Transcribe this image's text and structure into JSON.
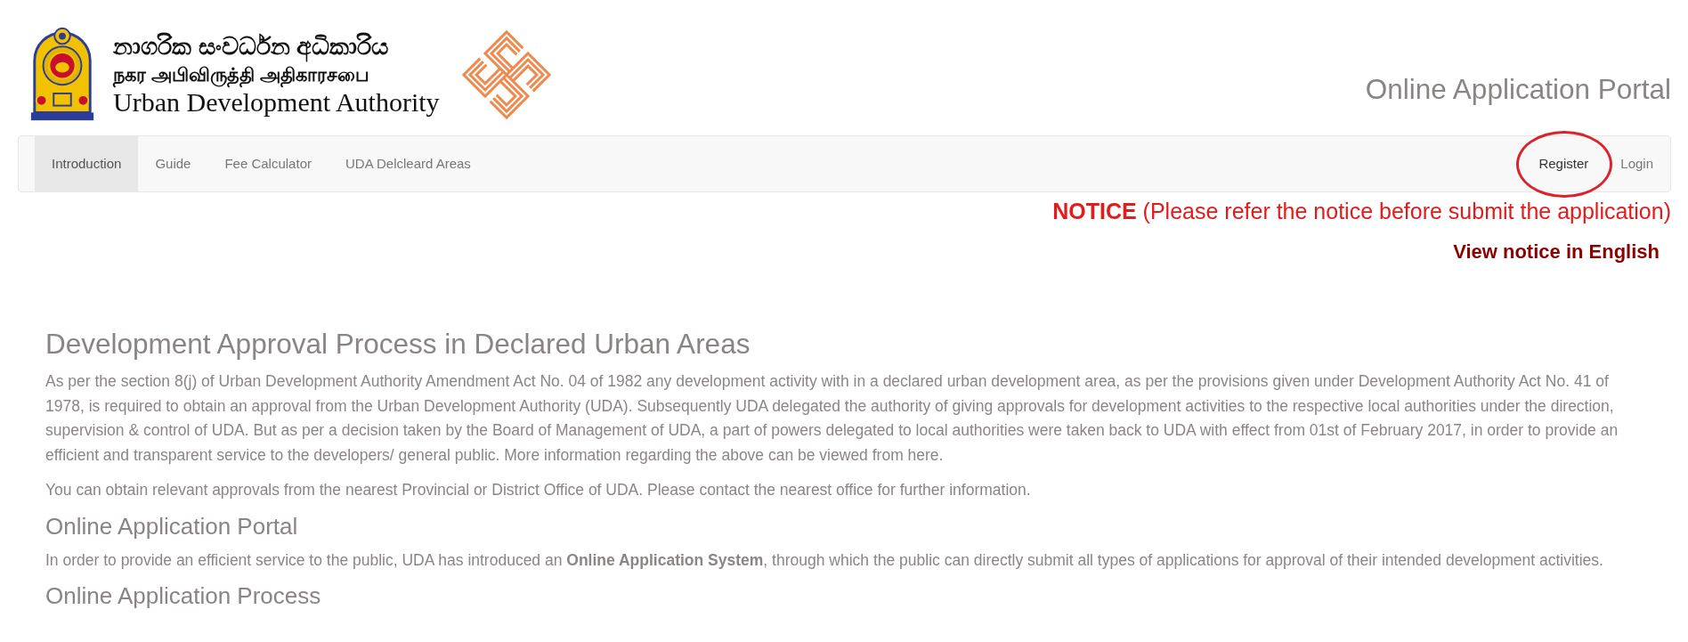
{
  "header": {
    "logo_lines": [
      "නාගරික සංවර්ධන අධිකාරිය",
      "நகர அபிவிருத்தி அதிகாரசபை",
      "Urban Development Authority"
    ],
    "portal_title": "Online Application Portal"
  },
  "navbar": {
    "left_items": [
      {
        "label": "Introduction",
        "selected": true
      },
      {
        "label": "Guide",
        "selected": false
      },
      {
        "label": "Fee Calculator",
        "selected": false
      },
      {
        "label": "UDA Delcleard Areas",
        "selected": false
      }
    ],
    "right_items": [
      {
        "label": "Register",
        "hovered": true,
        "circled": true
      },
      {
        "label": "Login",
        "hovered": false,
        "circled": false
      }
    ]
  },
  "notice": {
    "text": "**NOTICE** (Please refer the notice before submit the application)",
    "link": "View notice in English"
  },
  "content": [
    {
      "kind": "heading",
      "text": "Development Approval Process in Declared Urban Areas"
    },
    {
      "kind": "paragraph",
      "text": "As per the section 8(j) of Urban Development Authority Amendment Act No. 04 of 1982 any development activity with in a declared urban development area, as per the provisions given under Development Authority Act No. 41 of 1978, is required to obtain an approval from the Urban Development Authority (UDA). Subsequently UDA delegated the authority of giving approvals for development activities to the respective local authorities under the direction, supervision & control of UDA. But as per a decision taken by the Board of Management of UDA, a part of powers delegated to local authorities were taken back to UDA with effect from 01st of February 2017, in order to provide an efficient and transparent service to the developers/ general public. More information regarding the above can be viewed from here."
    },
    {
      "kind": "paragraph",
      "text": "You can obtain relevant approvals from the nearest Provincial or District Office of UDA. Please contact the nearest office for further information."
    },
    {
      "kind": "subheading",
      "text": "Online Application Portal"
    },
    {
      "kind": "paragraph",
      "text": "In order to provide an efficient service to the public, UDA has introduced an **Online Application System**, through which the public can directly submit all types of applications for approval of their intended development activities."
    },
    {
      "kind": "subheading",
      "text": "Online Application Process"
    }
  ]
}
